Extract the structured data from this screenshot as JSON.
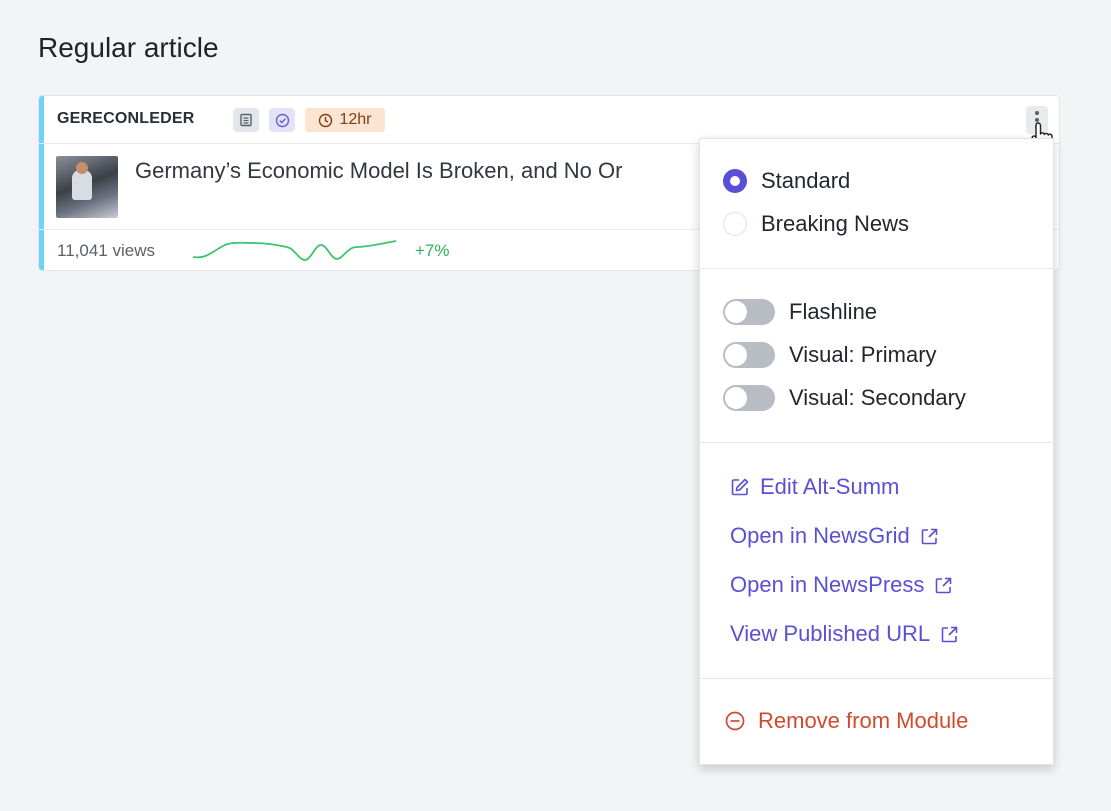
{
  "section": {
    "title": "Regular article"
  },
  "article": {
    "slug": "GERECONLEDER",
    "time_badge": "12hr",
    "headline": "Germany’s Economic Model Is Broken, and No Or",
    "views": "11,041 views",
    "trend": "+7%",
    "accent_color": "#6fd3f7"
  },
  "menu": {
    "radios": [
      {
        "label": "Standard",
        "checked": true
      },
      {
        "label": "Breaking News",
        "checked": false
      }
    ],
    "toggles": [
      {
        "label": "Flashline",
        "on": false
      },
      {
        "label": "Visual: Primary",
        "on": false
      },
      {
        "label": "Visual: Secondary",
        "on": false
      }
    ],
    "links": [
      {
        "label": "Edit Alt-Summ",
        "icon": "edit-icon"
      },
      {
        "label": "Open in NewsGrid",
        "icon": "external-link-icon"
      },
      {
        "label": "Open in NewsPress",
        "icon": "external-link-icon"
      },
      {
        "label": "View Published URL",
        "icon": "external-link-icon"
      }
    ],
    "remove_label": "Remove from Module",
    "link_color": "#5b4fd4",
    "danger_color": "#d14a2e"
  }
}
